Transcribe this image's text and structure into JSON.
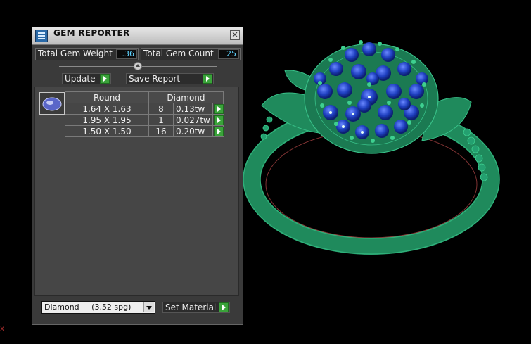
{
  "panel": {
    "title": "GEM REPORTER",
    "total_gem_weight_label": "Total Gem Weight",
    "total_gem_weight_value": ".36",
    "total_gem_count_label": "Total Gem Count",
    "total_gem_count_value": "25",
    "update_label": "Update",
    "save_report_label": "Save Report"
  },
  "table": {
    "header_shape": "Round",
    "header_material": "Diamond",
    "rows": [
      {
        "size": "1.64 X 1.63",
        "count": "8",
        "weight": "0.13tw"
      },
      {
        "size": "1.95 X 1.95",
        "count": "1",
        "weight": "0.027tw"
      },
      {
        "size": "1.50 X 1.50",
        "count": "16",
        "weight": "0.20tw"
      }
    ]
  },
  "material": {
    "selected": "Diamond     (3.52 spg)",
    "set_material_label": "Set Material"
  },
  "viewport": {
    "axis_label": "x"
  },
  "colors": {
    "ring_metal": "#1f8a5c",
    "gem": "#1e3fc0",
    "accent_green": "#3aa33a",
    "value_text": "#5fd3ff"
  },
  "icons": [
    "gem-reporter-app-icon",
    "close-icon",
    "slider-knob",
    "arrow-right-icon",
    "dropdown-arrow-icon"
  ]
}
